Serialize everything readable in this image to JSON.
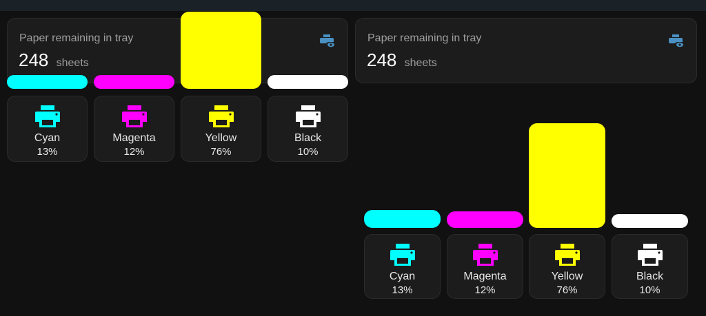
{
  "panels": [
    {
      "paper": {
        "label": "Paper remaining in tray",
        "value": "248",
        "unit": "sheets",
        "icon": "printer-eye-icon"
      },
      "inks": [
        {
          "name": "Cyan",
          "percent": "13%",
          "level": 0.13,
          "color": "#00ffff",
          "icon": "printer-icon"
        },
        {
          "name": "Magenta",
          "percent": "12%",
          "level": 0.12,
          "color": "#ff00ff",
          "icon": "printer-icon"
        },
        {
          "name": "Yellow",
          "percent": "76%",
          "level": 0.76,
          "color": "#ffff00",
          "icon": "printer-icon"
        },
        {
          "name": "Black",
          "percent": "10%",
          "level": 0.1,
          "color": "#ffffff",
          "icon": "printer-icon"
        }
      ]
    },
    {
      "paper": {
        "label": "Paper remaining in tray",
        "value": "248",
        "unit": "sheets",
        "icon": "printer-eye-icon"
      },
      "inks": [
        {
          "name": "Cyan",
          "percent": "13%",
          "level": 0.13,
          "color": "#00ffff",
          "icon": "printer-icon"
        },
        {
          "name": "Magenta",
          "percent": "12%",
          "level": 0.12,
          "color": "#ff00ff",
          "icon": "printer-icon"
        },
        {
          "name": "Yellow",
          "percent": "76%",
          "level": 0.76,
          "color": "#ffff00",
          "icon": "printer-icon"
        },
        {
          "name": "Black",
          "percent": "10%",
          "level": 0.1,
          "color": "#ffffff",
          "icon": "printer-icon"
        }
      ]
    }
  ],
  "accent": {
    "paper_icon": "#4a90c2"
  }
}
